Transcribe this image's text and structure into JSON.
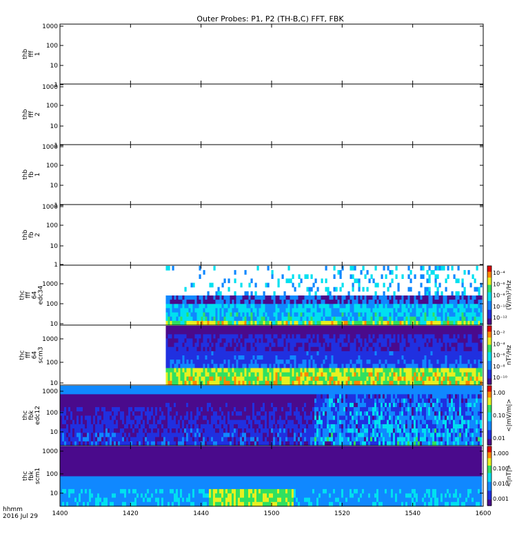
{
  "title": "Outer Probes: P1, P2 (TH-B,C) FFT, FBK",
  "time_labels": {
    "unit": "hhmm",
    "date": "2016 Jul 29"
  },
  "chart_data": [
    {
      "type": "heatmap",
      "panel_label": [
        "thb",
        "fff",
        "1"
      ],
      "x": [
        "1400",
        "1420",
        "1440",
        "1500",
        "1520",
        "1540",
        "1600"
      ],
      "y_ticks": [
        "1000",
        "100",
        "10",
        "1"
      ],
      "ylim": [
        1,
        1000
      ],
      "y_scale": "log",
      "data": "none",
      "colorbar": null
    },
    {
      "type": "heatmap",
      "panel_label": [
        "thb",
        "fff",
        "2"
      ],
      "x": [
        "1400",
        "1420",
        "1440",
        "1500",
        "1520",
        "1540",
        "1600"
      ],
      "y_ticks": [
        "1000",
        "100",
        "10",
        "1"
      ],
      "ylim": [
        1,
        1000
      ],
      "y_scale": "log",
      "data": "none",
      "colorbar": null
    },
    {
      "type": "heatmap",
      "panel_label": [
        "thb",
        "fb",
        "1"
      ],
      "x": [
        "1400",
        "1420",
        "1440",
        "1500",
        "1520",
        "1540",
        "1600"
      ],
      "y_ticks": [
        "1000",
        "100",
        "10",
        "1"
      ],
      "ylim": [
        1,
        1000
      ],
      "y_scale": "log",
      "data": "none",
      "colorbar": null
    },
    {
      "type": "heatmap",
      "panel_label": [
        "thb",
        "fb",
        "2"
      ],
      "x": [
        "1400",
        "1420",
        "1440",
        "1500",
        "1520",
        "1540",
        "1600"
      ],
      "y_ticks": [
        "1000",
        "100",
        "10",
        "1"
      ],
      "ylim": [
        1,
        1000
      ],
      "y_scale": "log",
      "data": "none",
      "colorbar": null
    },
    {
      "type": "heatmap",
      "panel_label": [
        "thc",
        "fff",
        "64",
        "edc34"
      ],
      "x": [
        "1400",
        "1420",
        "1440",
        "1500",
        "1520",
        "1540",
        "1600"
      ],
      "y_ticks": [
        "1000",
        "100",
        "10"
      ],
      "ylim": [
        8,
        8000
      ],
      "y_scale": "log",
      "data_start": "1430",
      "colorbar": {
        "label": "(V/m)²/Hz",
        "ticks": [
          "10⁻⁴",
          "10⁻⁶",
          "10⁻⁸",
          "10⁻¹⁰",
          "10⁻¹²"
        ]
      }
    },
    {
      "type": "heatmap",
      "panel_label": [
        "thc",
        "fff",
        "64",
        "scm3"
      ],
      "x": [
        "1400",
        "1420",
        "1440",
        "1500",
        "1520",
        "1540",
        "1600"
      ],
      "y_ticks": [
        "1000",
        "100",
        "10"
      ],
      "ylim": [
        8,
        8000
      ],
      "y_scale": "log",
      "data_start": "1430",
      "colorbar": {
        "label": "nT²/Hz",
        "ticks": [
          "10⁻²",
          "10⁻⁴",
          "10⁻⁶",
          "10⁻⁸",
          "10⁻¹⁰"
        ]
      }
    },
    {
      "type": "heatmap",
      "panel_label": [
        "thc",
        "fbk",
        "edc12"
      ],
      "x": [
        "1400",
        "1420",
        "1440",
        "1500",
        "1520",
        "1540",
        "1600"
      ],
      "y_ticks": [
        "1000",
        "100",
        "10"
      ],
      "ylim": [
        2,
        2000
      ],
      "y_scale": "log",
      "data_start": "1400",
      "colorbar": {
        "label": "<|mV/m|>",
        "ticks": [
          "1.00",
          "0.10",
          "0.01"
        ]
      }
    },
    {
      "type": "heatmap",
      "panel_label": [
        "thc",
        "fbk",
        "scm1"
      ],
      "x": [
        "1400",
        "1420",
        "1440",
        "1500",
        "1520",
        "1540",
        "1600"
      ],
      "y_ticks": [
        "1000",
        "100",
        "10"
      ],
      "ylim": [
        2,
        2000
      ],
      "y_scale": "log",
      "data_start": "1400",
      "colorbar": {
        "label": "<|nT|>",
        "ticks": [
          "1.000",
          "0.100",
          "0.010",
          "0.001"
        ]
      }
    }
  ]
}
